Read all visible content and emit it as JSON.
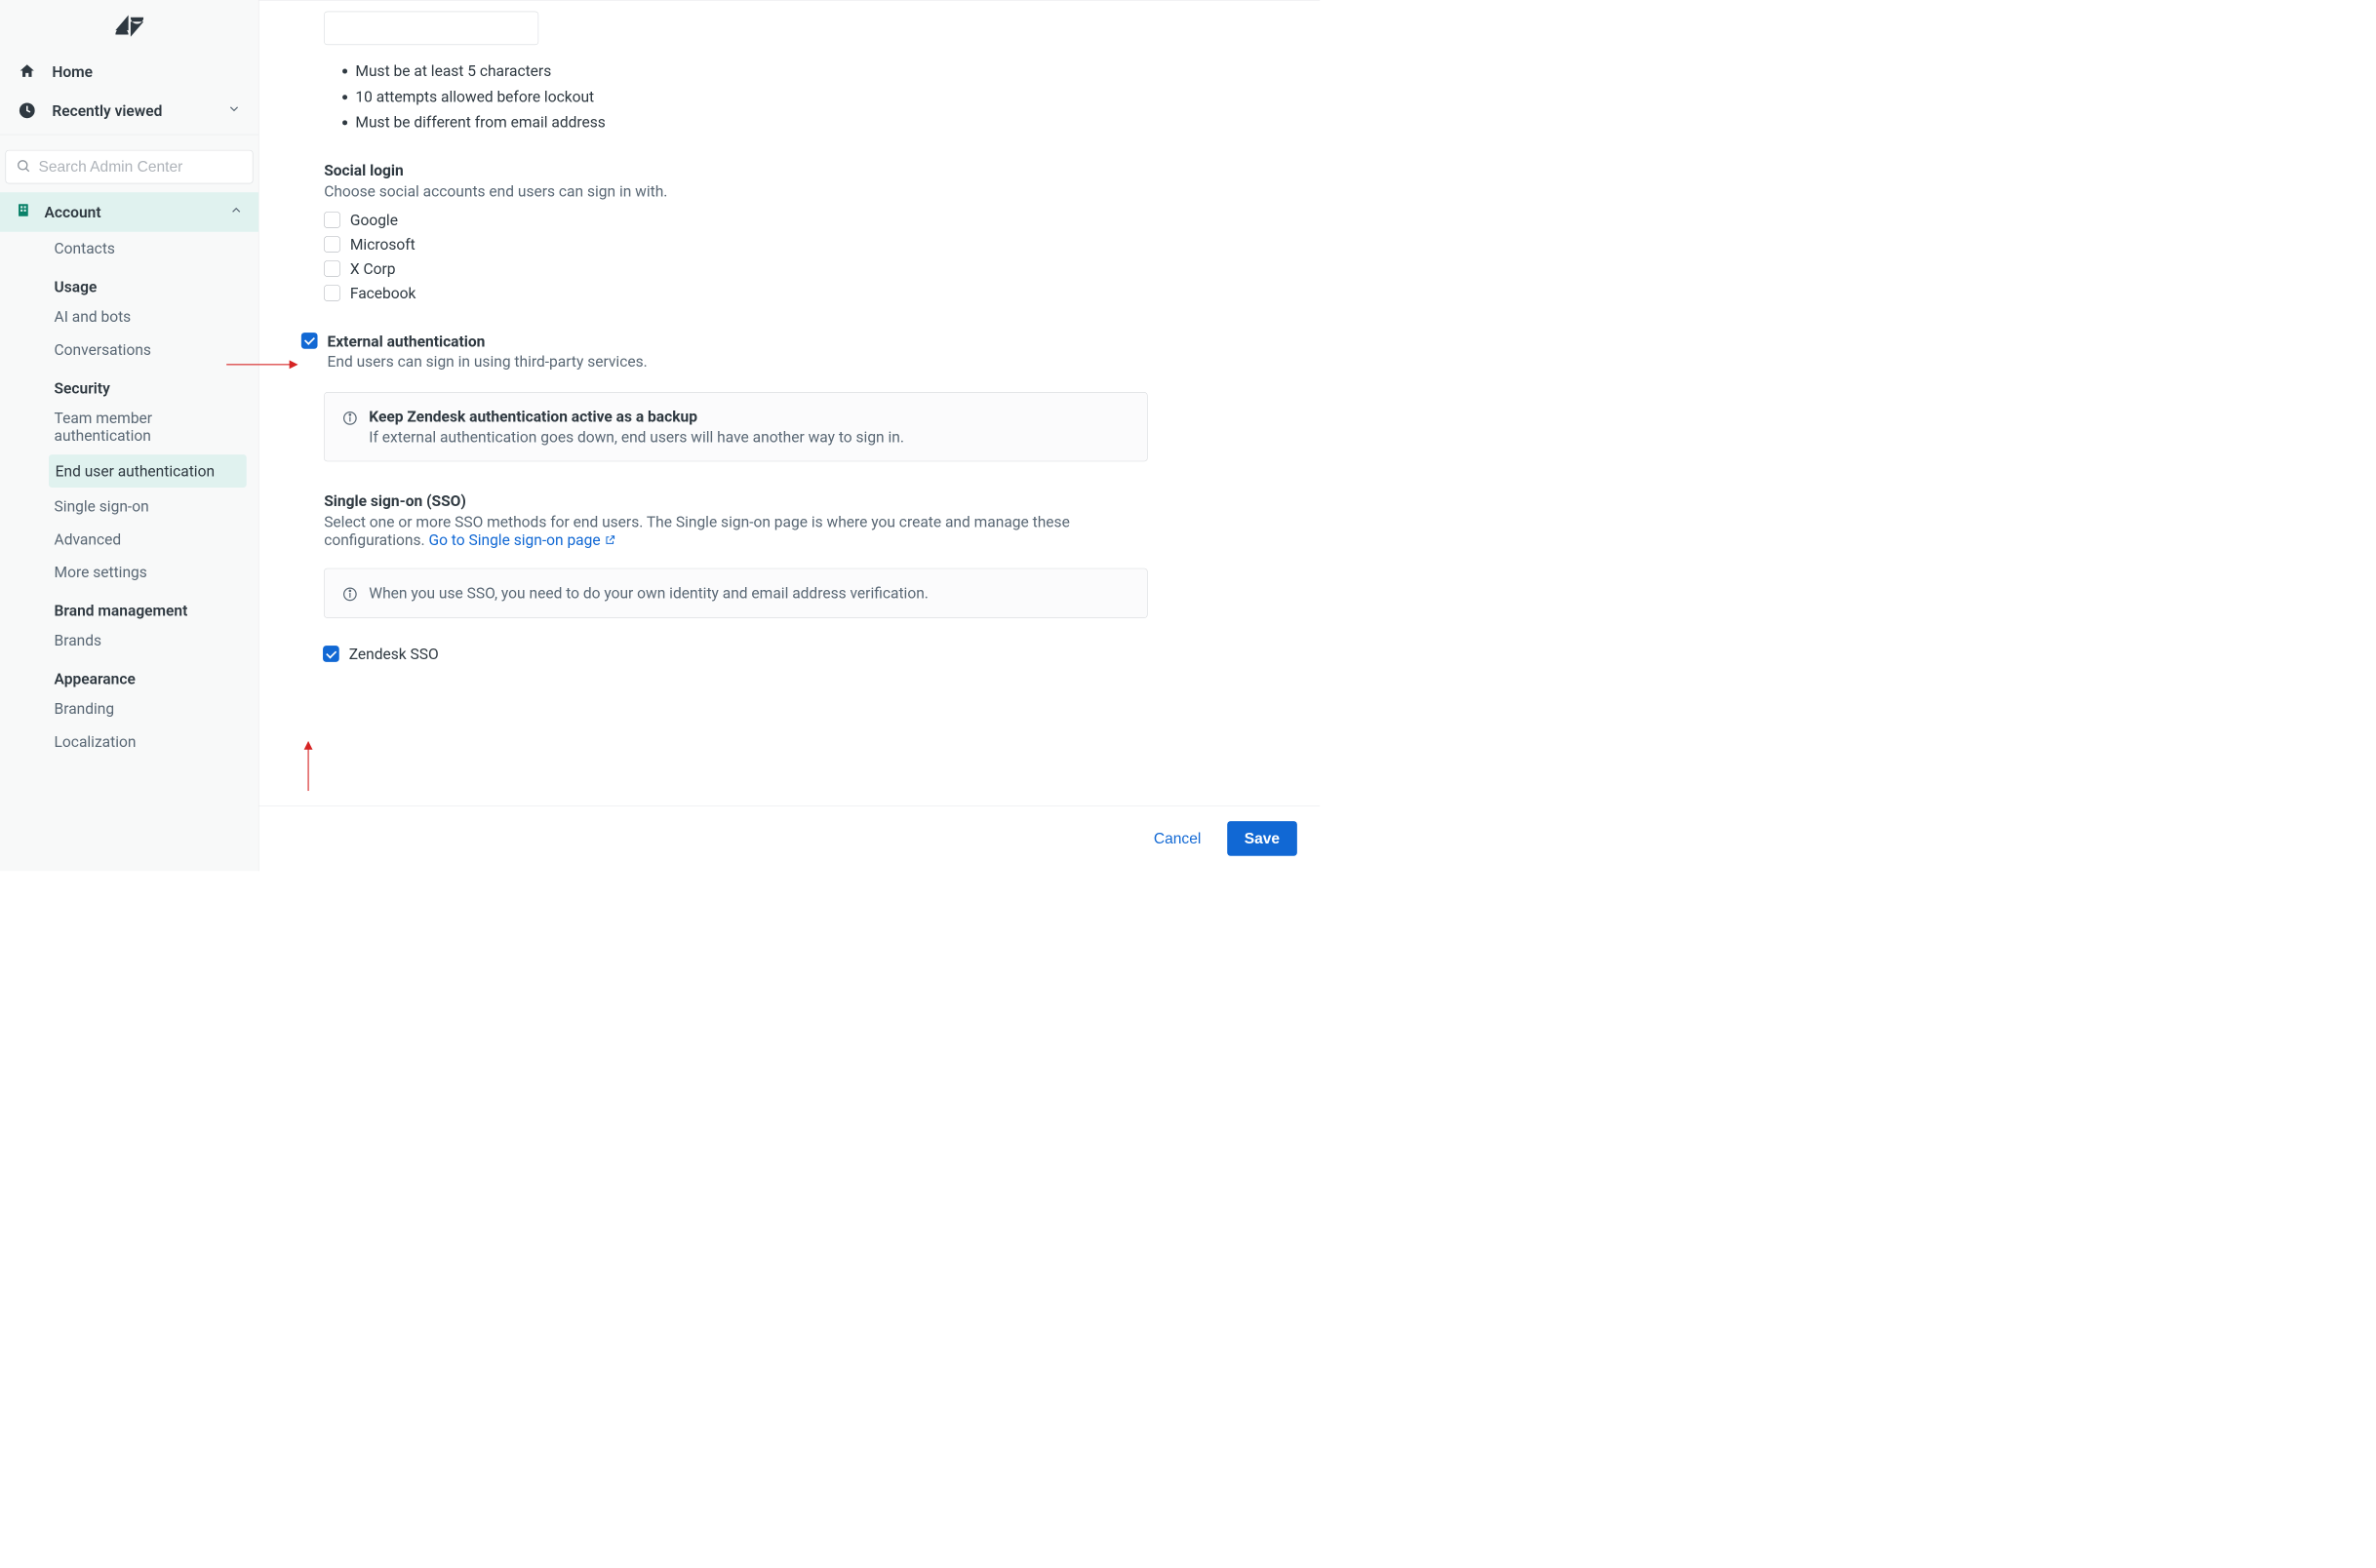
{
  "sidebar": {
    "home": "Home",
    "recently_viewed": "Recently viewed",
    "search_placeholder": "Search Admin Center",
    "section": "Account",
    "items": {
      "contacts": "Contacts",
      "group_usage": "Usage",
      "ai_and_bots": "AI and bots",
      "conversations": "Conversations",
      "group_security": "Security",
      "team_member_auth": "Team member authentication",
      "end_user_auth": "End user authentication",
      "sso": "Single sign-on",
      "advanced": "Advanced",
      "more_settings": "More settings",
      "group_brand": "Brand management",
      "brands": "Brands",
      "group_appearance": "Appearance",
      "branding": "Branding",
      "localization": "Localization"
    }
  },
  "password_rules": {
    "r1": "Must be at least 5 characters",
    "r2": "10 attempts allowed before lockout",
    "r3": "Must be different from email address"
  },
  "social_login": {
    "title": "Social login",
    "desc": "Choose social accounts end users can sign in with.",
    "google": "Google",
    "microsoft": "Microsoft",
    "xcorp": "X Corp",
    "facebook": "Facebook"
  },
  "external_auth": {
    "title": "External authentication",
    "desc": "End users can sign in using third-party services."
  },
  "backup_box": {
    "title": "Keep Zendesk authentication active as a backup",
    "desc": "If external authentication goes down, end users will have another way to sign in."
  },
  "sso": {
    "title": "Single sign-on (SSO)",
    "desc_pre": "Select one or more SSO methods for end users. The Single sign-on page is where you create and manage these configurations. ",
    "link": "Go to Single sign-on page",
    "info": "When you use SSO, you need to do your own identity and email address verification."
  },
  "zendesk_sso": "Zendesk SSO",
  "footer": {
    "cancel": "Cancel",
    "save": "Save"
  }
}
